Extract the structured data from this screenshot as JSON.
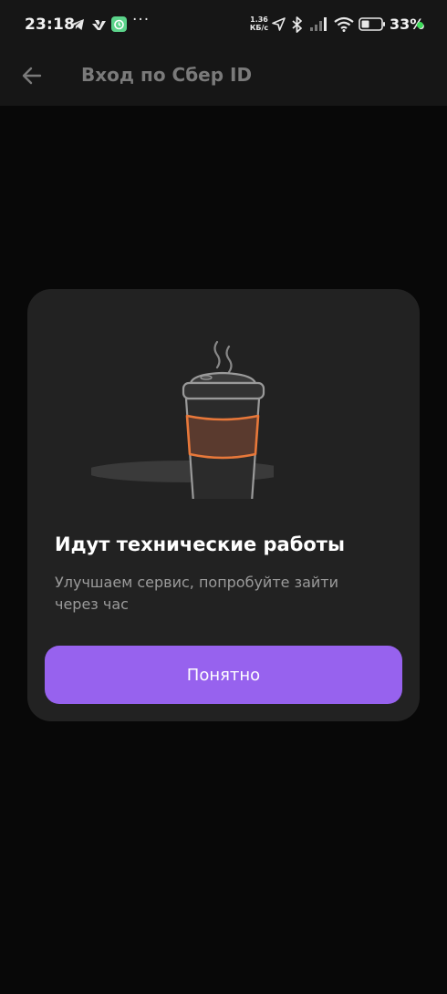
{
  "status_bar": {
    "time": "23:18",
    "net_speed_value": "1.36",
    "net_speed_unit": "КБ/с",
    "battery": "33%",
    "battery_level": 0.33,
    "icons": [
      "telegram-icon",
      "vk-icon",
      "alarm-app-icon",
      "more-dots-icon",
      "location-arrow-icon",
      "bluetooth-icon",
      "signal-icon",
      "wifi-icon",
      "battery-icon"
    ],
    "more_dots": "···"
  },
  "app_bar": {
    "title": "Вход по Сбер ID",
    "back_icon": "arrow-left-icon"
  },
  "dialog": {
    "illustration": "coffee-cup-icon",
    "title": "Идут технические работы",
    "subtitle": "Улучшаем сервис, попробуйте зайти через час",
    "button_label": "Понятно",
    "colors": {
      "card": "#222222",
      "button": "#9762ee",
      "sleeve": "#e8783a",
      "coffee": "#5a3a2e"
    }
  }
}
